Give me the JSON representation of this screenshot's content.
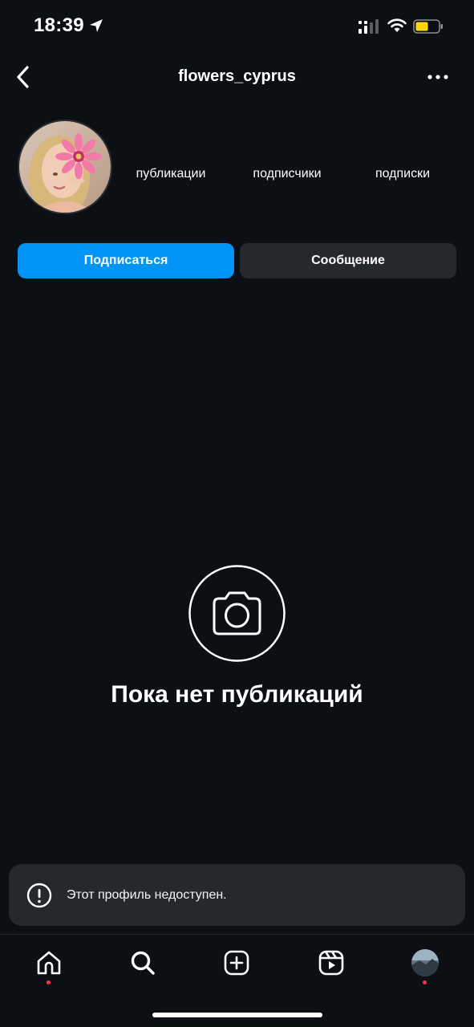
{
  "status_bar": {
    "time": "18:39"
  },
  "header": {
    "username": "flowers_cyprus",
    "icons": {
      "back": "chevron-left-icon",
      "more": "more-horizontal-icon"
    }
  },
  "profile": {
    "stats": {
      "posts_label": "публикации",
      "followers_label": "подписчики",
      "following_label": "подписки"
    },
    "actions": {
      "follow_label": "Подписаться",
      "message_label": "Сообщение"
    }
  },
  "empty_state": {
    "icon": "camera-icon",
    "title": "Пока нет публикаций"
  },
  "toast": {
    "icon": "alert-circle-icon",
    "text": "Этот профиль недоступен."
  },
  "bottom_nav": {
    "items": [
      "home-icon",
      "search-icon",
      "create-icon",
      "reels-icon",
      "profile-avatar"
    ]
  },
  "colors": {
    "background": "#0c1014",
    "primary_button": "#0095f6",
    "secondary_button": "#25292e",
    "notification_dot": "#ff3040",
    "battery_fill": "#ffd60a"
  }
}
